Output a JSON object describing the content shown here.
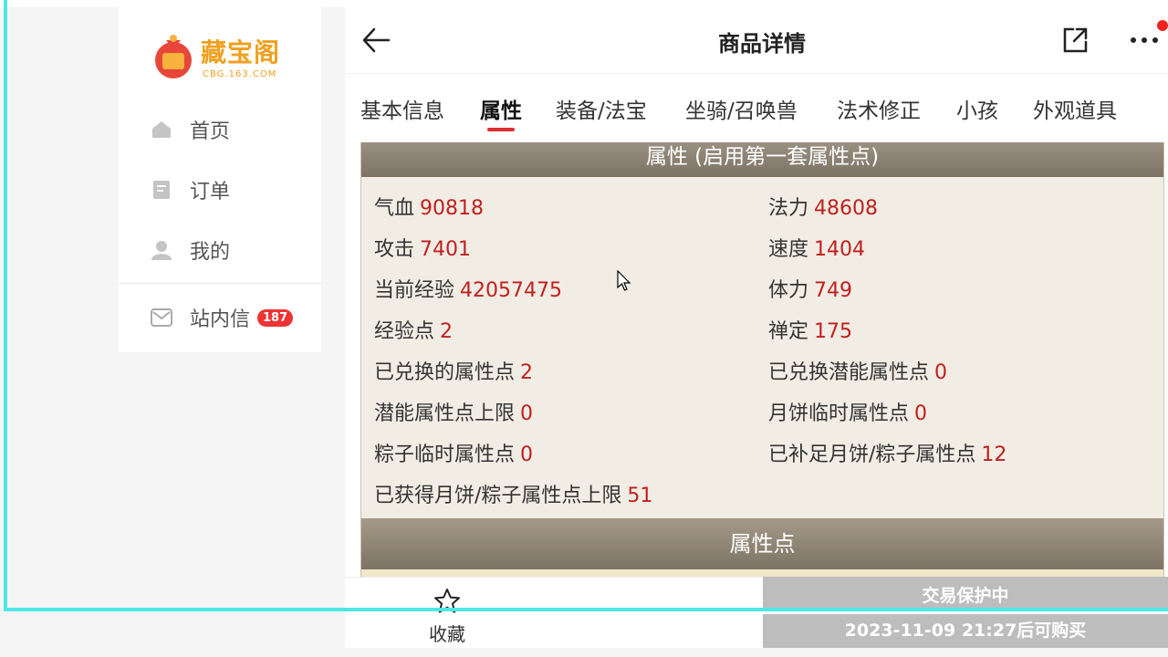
{
  "sidebar": {
    "logo_text": "藏宝阁",
    "logo_sub": "CBG.163.COM",
    "items": [
      {
        "label": "首页",
        "icon": "home-icon"
      },
      {
        "label": "订单",
        "icon": "order-icon"
      },
      {
        "label": "我的",
        "icon": "user-icon"
      },
      {
        "label": "站内信",
        "icon": "mail-icon",
        "badge": "187"
      }
    ]
  },
  "header": {
    "title": "商品详情"
  },
  "tabs": [
    {
      "label": "基本信息"
    },
    {
      "label": "属性",
      "active": true
    },
    {
      "label": "装备/法宝"
    },
    {
      "label": "坐骑/召唤兽"
    },
    {
      "label": "法术修正"
    },
    {
      "label": "小孩"
    },
    {
      "label": "外观道具"
    }
  ],
  "attributes": {
    "section_title": "属性 (启用第一套属性点)",
    "left": [
      {
        "label": "气血",
        "value": "90818"
      },
      {
        "label": "攻击",
        "value": "7401"
      },
      {
        "label": "当前经验",
        "value": "42057475"
      },
      {
        "label": "经验点",
        "value": "2"
      },
      {
        "label": "已兑换的属性点",
        "value": "2"
      },
      {
        "label": "潜能属性点上限",
        "value": "0"
      },
      {
        "label": "粽子临时属性点",
        "value": "0"
      },
      {
        "label": "已获得月饼/粽子属性点上限",
        "value": "51"
      }
    ],
    "right": [
      {
        "label": "法力",
        "value": "48608"
      },
      {
        "label": "速度",
        "value": "1404"
      },
      {
        "label": "体力",
        "value": "749"
      },
      {
        "label": "禅定",
        "value": "175"
      },
      {
        "label": "已兑换潜能属性点",
        "value": "0"
      },
      {
        "label": "月饼临时属性点",
        "value": "0"
      },
      {
        "label": "已补足月饼/粽子属性点",
        "value": "12"
      }
    ],
    "section2_title": "属性点"
  },
  "bottom": {
    "fav_label": "收藏",
    "buy_line1": "交易保护中",
    "buy_line2": "2023-11-09 21:27后可购买"
  },
  "colors": {
    "accent": "#d93030",
    "value_red": "#c0201f",
    "header_brown": "#8a8070",
    "panel_bg": "#f2ede4"
  }
}
